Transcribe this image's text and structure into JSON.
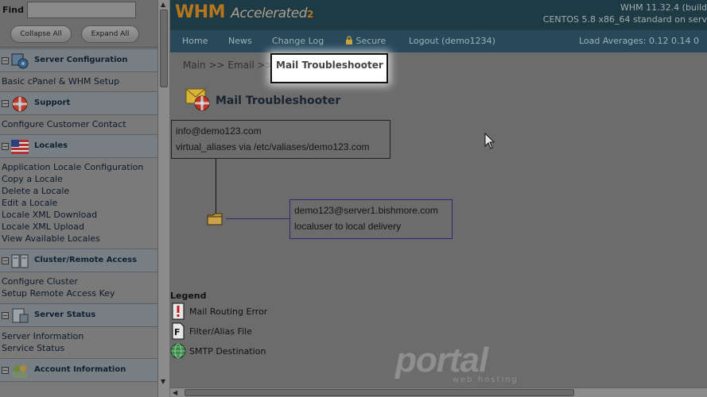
{
  "sidebar": {
    "find_label": "Find",
    "find_value": "",
    "collapse_label": "Collapse All",
    "expand_label": "Expand All",
    "sections": [
      {
        "title": "Server Configuration",
        "icon": "gear-icon",
        "links": [
          "Basic cPanel & WHM Setup"
        ]
      },
      {
        "title": "Support",
        "icon": "lifebuoy-icon",
        "links": [
          "Configure Customer Contact"
        ]
      },
      {
        "title": "Locales",
        "icon": "flag-icon",
        "links": [
          "Application Locale Configuration",
          "Copy a Locale",
          "Delete a Locale",
          "Edit a Locale",
          "Locale XML Download",
          "Locale XML Upload",
          "View Available Locales"
        ]
      },
      {
        "title": "Cluster/Remote Access",
        "icon": "servers-icon",
        "links": [
          "Configure Cluster",
          "Setup Remote Access Key"
        ]
      },
      {
        "title": "Server Status",
        "icon": "monitor-icon",
        "links": [
          "Server Information",
          "Service Status"
        ]
      },
      {
        "title": "Account Information",
        "icon": "users-icon",
        "links": []
      }
    ]
  },
  "header": {
    "logo_main": "WHM",
    "logo_accent": "Accelerated",
    "logo_version": "2",
    "server_line1": "WHM 11.32.4 (build",
    "server_line2": "CENTOS 5.8 x86_64 standard on serv"
  },
  "nav": {
    "home": "Home",
    "news": "News",
    "changelog": "Change Log",
    "secure": "Secure",
    "logout": "Logout (demo1234)",
    "load_averages": "Load Averages: 0.12 0.14 0"
  },
  "breadcrumb": {
    "prefix": "Main >> Email >>",
    "current": "Mail Troubleshooter"
  },
  "page": {
    "title": "Mail Troubleshooter",
    "route1": {
      "line1": "info@demo123.com",
      "line2": "virtual_aliases via /etc/valiases/demo123.com"
    },
    "route2": {
      "line1": "demo123@server1.bishmore.com",
      "line2": "localuser to local delivery"
    }
  },
  "legend": {
    "title": "Legend",
    "items": [
      {
        "label": "Mail Routing Error",
        "icon": "error-icon"
      },
      {
        "label": "Filter/Alias File",
        "icon": "file-icon"
      },
      {
        "label": "SMTP Destination",
        "icon": "globe-icon"
      }
    ]
  },
  "watermark": {
    "text": "portal",
    "sub": "web hosting"
  },
  "colors": {
    "header_bg": "#1e3a44",
    "nav_bg": "#27495a",
    "logo": "#b4761c",
    "content_bg": "#6c6c6c"
  }
}
